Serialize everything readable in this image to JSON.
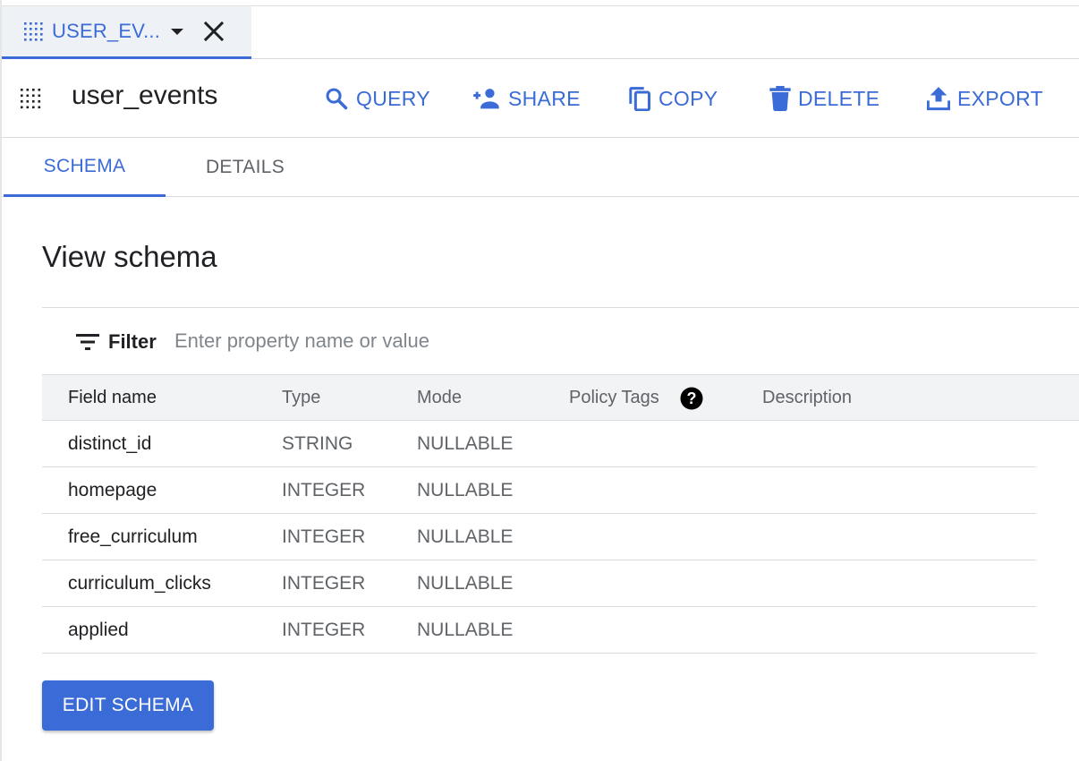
{
  "tabstrip": {
    "tab_title": "USER_EV...",
    "icons": {
      "grid": "table-grid-icon",
      "caret": "caret-down-icon",
      "close": "close-icon"
    }
  },
  "header": {
    "title": "user_events",
    "actions": [
      {
        "label": "QUERY",
        "icon": "search-icon"
      },
      {
        "label": "SHARE",
        "icon": "person-add-icon"
      },
      {
        "label": "COPY",
        "icon": "copy-icon"
      },
      {
        "label": "DELETE",
        "icon": "trash-icon"
      },
      {
        "label": "EXPORT",
        "icon": "upload-icon"
      }
    ]
  },
  "subtabs": [
    {
      "label": "SCHEMA",
      "active": true
    },
    {
      "label": "DETAILS",
      "active": false
    }
  ],
  "content": {
    "title": "View schema",
    "filter": {
      "label": "Filter",
      "placeholder": "Enter property name or value",
      "value": ""
    },
    "columns": [
      "Field name",
      "Type",
      "Mode",
      "Policy Tags",
      "Description"
    ],
    "rows": [
      {
        "name": "distinct_id",
        "type": "STRING",
        "mode": "NULLABLE",
        "tags": "",
        "description": ""
      },
      {
        "name": "homepage",
        "type": "INTEGER",
        "mode": "NULLABLE",
        "tags": "",
        "description": ""
      },
      {
        "name": "free_curriculum",
        "type": "INTEGER",
        "mode": "NULLABLE",
        "tags": "",
        "description": ""
      },
      {
        "name": "curriculum_clicks",
        "type": "INTEGER",
        "mode": "NULLABLE",
        "tags": "",
        "description": ""
      },
      {
        "name": "applied",
        "type": "INTEGER",
        "mode": "NULLABLE",
        "tags": "",
        "description": ""
      }
    ],
    "edit_button": "EDIT SCHEMA"
  },
  "colors": {
    "accent": "#3b6bd6",
    "text": "#202124",
    "muted": "#5f6368",
    "divider": "#dadce0"
  }
}
